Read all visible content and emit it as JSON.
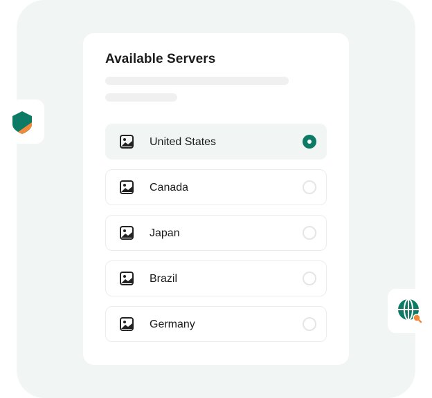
{
  "card": {
    "title": "Available Servers"
  },
  "servers": [
    {
      "name": "United States",
      "selected": true
    },
    {
      "name": "Canada",
      "selected": false
    },
    {
      "name": "Japan",
      "selected": false
    },
    {
      "name": "Brazil",
      "selected": false
    },
    {
      "name": "Germany",
      "selected": false
    }
  ],
  "icons": {
    "left_badge": "shield-icon",
    "right_badge": "globe-search-icon",
    "server_flag": "image-placeholder-icon"
  },
  "colors": {
    "accent": "#0c7a65",
    "accent_orange": "#f2883a",
    "backdrop": "#f1f6f5",
    "text": "#1c1c1c"
  }
}
